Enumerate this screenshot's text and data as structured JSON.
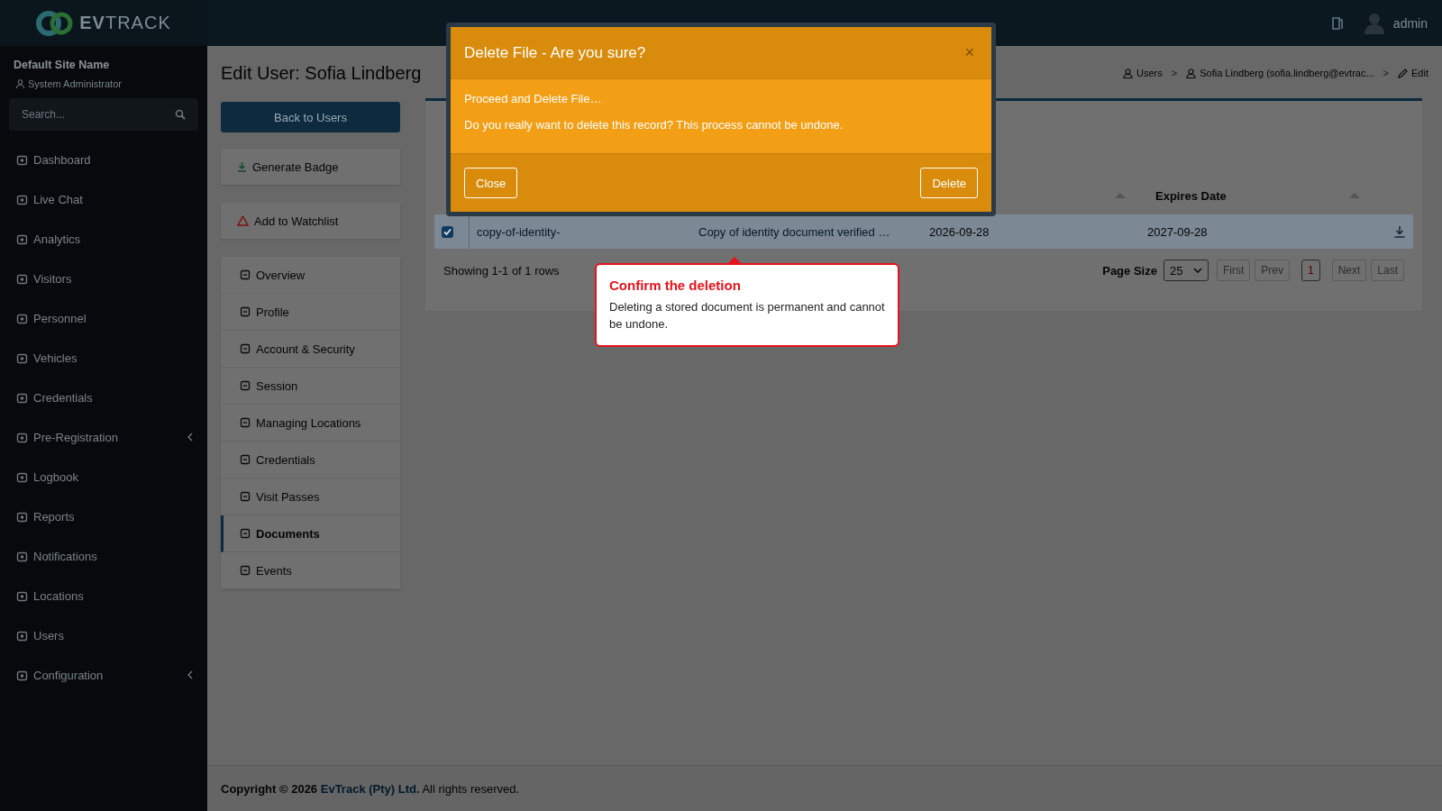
{
  "header": {
    "logo": "**EV**TRACK",
    "user": "admin"
  },
  "sidebar": {
    "site": "Default Site Name",
    "role": "System Administrator",
    "search": {
      "placeholder": "Search..."
    },
    "items": [
      {
        "label": "Dashboard",
        "expandable": false
      },
      {
        "label": "Live Chat",
        "expandable": false
      },
      {
        "label": "Analytics",
        "expandable": false
      },
      {
        "label": "Visitors",
        "expandable": false
      },
      {
        "label": "Personnel",
        "expandable": false
      },
      {
        "label": "Vehicles",
        "expandable": false
      },
      {
        "label": "Credentials",
        "expandable": false
      },
      {
        "label": "Pre-Registration",
        "expandable": true
      },
      {
        "label": "Logbook",
        "expandable": false
      },
      {
        "label": "Reports",
        "expandable": false
      },
      {
        "label": "Notifications",
        "expandable": false
      },
      {
        "label": "Locations",
        "expandable": false
      },
      {
        "label": "Users",
        "expandable": false
      },
      {
        "label": "Configuration",
        "expandable": true
      }
    ]
  },
  "page": {
    "title": "Edit User: Sofia Lindberg",
    "separator": ">",
    "breadcrumbs": [
      "Users",
      "Sofia Lindberg (sofia.lindberg@evtrac...",
      "Edit"
    ]
  },
  "back_button": "Back to Users",
  "actions": [
    "Generate Badge",
    "Add to Watchlist"
  ],
  "nav": [
    {
      "label": "Overview",
      "selected": false
    },
    {
      "label": "Profile",
      "selected": false
    },
    {
      "label": "Account & Security",
      "selected": false
    },
    {
      "label": "Session",
      "selected": false
    },
    {
      "label": "Managing Locations",
      "selected": false
    },
    {
      "label": "Credentials",
      "selected": false
    },
    {
      "label": "Visit Passes",
      "selected": false
    },
    {
      "label": "Documents",
      "selected": true
    },
    {
      "label": "Events",
      "selected": false
    }
  ],
  "table": {
    "columns": [
      "Expires Date"
    ],
    "rows": [
      {
        "checked": true,
        "selected": true,
        "file": "copy-of-identity-",
        "description": "Copy of identity document verified …",
        "date": "2026-09-28",
        "expires": "2027-09-28"
      }
    ],
    "summary": "Showing 1-1 of 1 rows",
    "page_size_label": "Page Size",
    "page_size": "25",
    "pager": [
      {
        "label": "First",
        "selected": false,
        "disabled": true
      },
      {
        "label": "Prev",
        "selected": false,
        "disabled": true
      },
      {
        "label": "1",
        "selected": true,
        "disabled": false
      },
      {
        "label": "Next",
        "selected": false,
        "disabled": true
      },
      {
        "label": "Last",
        "selected": false,
        "disabled": true
      }
    ]
  },
  "footer": {
    "prefix": "Copyright © 2026",
    "link": "EvTrack (Pty) Ltd.",
    "suffix": "All rights reserved."
  },
  "modal": {
    "title": "Delete File - Are you sure?",
    "close": "×",
    "lines": [
      "Proceed and Delete File…",
      "Do you really want to delete this record? This process cannot be undone."
    ],
    "buttons": [
      "Close",
      "Delete"
    ]
  },
  "tooltip": {
    "title": "Confirm the deletion",
    "text": "Deleting a stored document is permanent and cannot be undone."
  }
}
